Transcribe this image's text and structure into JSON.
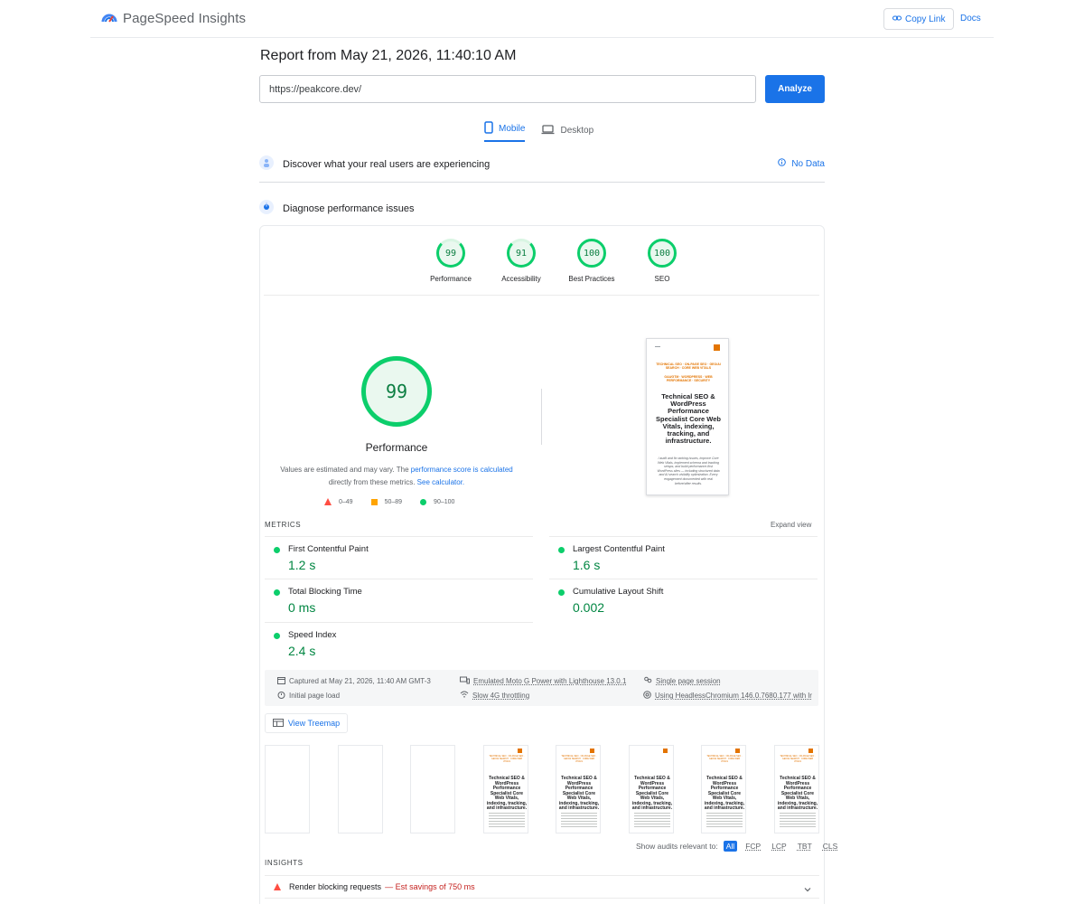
{
  "header": {
    "title": "PageSpeed Insights",
    "copy_link_label": "Copy Link",
    "docs_label": "Docs"
  },
  "report": {
    "title": "Report from May 21, 2026, 11:40:10 AM",
    "url_value": "https://peakcore.dev/",
    "analyze_label": "Analyze"
  },
  "device_tabs": [
    {
      "label": "Mobile",
      "active": true
    },
    {
      "label": "Desktop",
      "active": false
    }
  ],
  "field_data": {
    "title": "Discover what your real users are experiencing",
    "status": "No Data"
  },
  "diagnose": {
    "title": "Diagnose performance issues"
  },
  "category_scores": [
    {
      "score": "99",
      "label": "Performance"
    },
    {
      "score": "91",
      "label": "Accessibility"
    },
    {
      "score": "100",
      "label": "Best Practices"
    },
    {
      "score": "100",
      "label": "SEO"
    }
  ],
  "performance": {
    "score": "99",
    "label": "Performance",
    "disclaimer_pre": "Values are estimated and may vary. The",
    "disclaimer_link1": "performance score is calculated",
    "disclaimer_mid": "directly from these metrics.",
    "disclaimer_link2": "See calculator.",
    "legend": {
      "fail": "0–49",
      "average": "50–89",
      "pass": "90–100"
    }
  },
  "screenshot": {
    "tagline_1": "TECHNICAL SEO · ON-PAGE SEO · GEO/AI SEARCH · CORE WEB VITALS",
    "tagline_2": "GA4/GTM · WORDPRESS · WEB PERFORMANCE · SECURITY",
    "headline": "Technical SEO & WordPress Performance Specialist Core Web Vitals, indexing, tracking, and infrastructure.",
    "body": "I audit and fix ranking issues, improve Core Web Vitals, implement schema and tracking setups, and build performance-first WordPress sites — including structured data and AI search visibility optimization. Every engagement documented with real before/after results."
  },
  "metrics": {
    "label": "METRICS",
    "expand_label": "Expand view",
    "items": [
      {
        "name": "First Contentful Paint",
        "value": "1.2 s"
      },
      {
        "name": "Largest Contentful Paint",
        "value": "1.6 s"
      },
      {
        "name": "Total Blocking Time",
        "value": "0 ms"
      },
      {
        "name": "Cumulative Layout Shift",
        "value": "0.002"
      },
      {
        "name": "Speed Index",
        "value": "2.4 s"
      }
    ]
  },
  "run_info": {
    "captured": "Captured at May 21, 2026, 11:40 AM GMT-3",
    "load_type": "Initial page load",
    "device": "Emulated Moto G Power with Lighthouse 13.0.1",
    "network": "Slow 4G throttling",
    "session": "Single page session",
    "browser": "Using HeadlessChromium 146.0.7680.177 with lr"
  },
  "treemap_label": "View Treemap",
  "filmstrip": {
    "headline": "Technical SEO & WordPress Performance Specialist Core Web Vitals, indexing, tracking, and infrastructure."
  },
  "audits_filter": {
    "label": "Show audits relevant to:",
    "chips": [
      "All",
      "FCP",
      "LCP",
      "TBT",
      "CLS"
    ]
  },
  "insights": {
    "label": "INSIGHTS",
    "items": [
      {
        "title": "Render blocking requests",
        "savings": "— Est savings of 750 ms"
      }
    ]
  },
  "colors": {
    "accent": "#1a73e8",
    "pass": "#0cce6b",
    "pass_text": "#018642",
    "average": "#ffa400",
    "fail": "#ff4e42"
  }
}
